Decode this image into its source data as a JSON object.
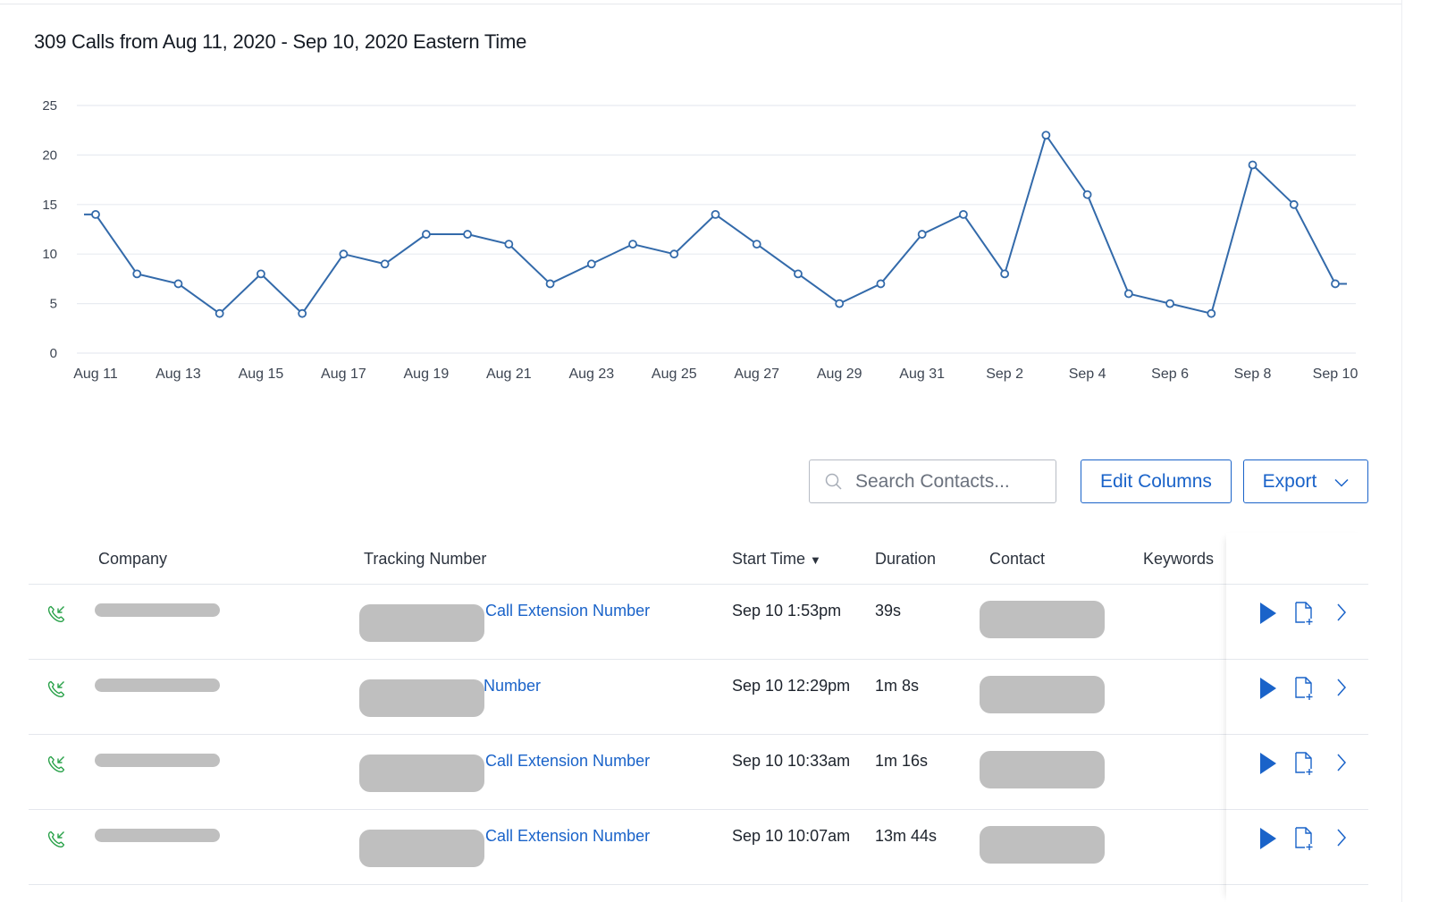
{
  "header": {
    "title": "309 Calls from Aug 11, 2020 - Sep 10, 2020 Eastern Time"
  },
  "chart_data": {
    "type": "line",
    "title": "309 Calls from Aug 11, 2020 - Sep 10, 2020 Eastern Time",
    "xlabel": "",
    "ylabel": "",
    "ylim": [
      0,
      25
    ],
    "yticks": [
      0,
      5,
      10,
      15,
      20,
      25
    ],
    "grid": true,
    "legend": "none",
    "x": [
      "Aug 11",
      "Aug 12",
      "Aug 13",
      "Aug 14",
      "Aug 15",
      "Aug 16",
      "Aug 17",
      "Aug 18",
      "Aug 19",
      "Aug 20",
      "Aug 21",
      "Aug 22",
      "Aug 23",
      "Aug 24",
      "Aug 25",
      "Aug 26",
      "Aug 27",
      "Aug 28",
      "Aug 29",
      "Aug 30",
      "Aug 31",
      "Sep 1",
      "Sep 2",
      "Sep 3",
      "Sep 4",
      "Sep 5",
      "Sep 6",
      "Sep 7",
      "Sep 8",
      "Sep 9",
      "Sep 10"
    ],
    "xtick_labels": [
      "Aug 11",
      "Aug 13",
      "Aug 15",
      "Aug 17",
      "Aug 19",
      "Aug 21",
      "Aug 23",
      "Aug 25",
      "Aug 27",
      "Aug 29",
      "Aug 31",
      "Sep 2",
      "Sep 4",
      "Sep 6",
      "Sep 8",
      "Sep 10"
    ],
    "series": [
      {
        "name": "Calls",
        "color": "#336aaa",
        "values": [
          14,
          8,
          7,
          4,
          8,
          4,
          10,
          9,
          12,
          12,
          11,
          7,
          9,
          11,
          10,
          14,
          11,
          8,
          5,
          7,
          12,
          14,
          8,
          22,
          16,
          6,
          5,
          4,
          19,
          15,
          7
        ]
      }
    ]
  },
  "toolbar": {
    "search_placeholder": "Search Contacts...",
    "search_value": "",
    "edit_columns_label": "Edit Columns",
    "export_label": "Export"
  },
  "table": {
    "columns": {
      "company": "Company",
      "tracking_number": "Tracking Number",
      "start_time": "Start Time",
      "duration": "Duration",
      "contact": "Contact",
      "keywords": "Keywords"
    },
    "sort_indicator": "▼",
    "rows": [
      {
        "call_direction": "inbound",
        "tracking_label": "Call Extension Number",
        "start_time": "Sep 10 1:53pm",
        "duration": "39s",
        "keywords": ""
      },
      {
        "call_direction": "inbound",
        "tracking_label": "Number",
        "start_time": "Sep 10 12:29pm",
        "duration": "1m 8s",
        "keywords": ""
      },
      {
        "call_direction": "inbound",
        "tracking_label": "Call Extension Number",
        "start_time": "Sep 10 10:33am",
        "duration": "1m 16s",
        "keywords": ""
      },
      {
        "call_direction": "inbound",
        "tracking_label": "Call Extension Number",
        "start_time": "Sep 10 10:07am",
        "duration": "13m 44s",
        "keywords": ""
      }
    ]
  },
  "colors": {
    "accent": "#1a63c9",
    "line": "#336aaa",
    "inbound_icon": "#2aa24a",
    "redaction": "#bfbfbf"
  }
}
